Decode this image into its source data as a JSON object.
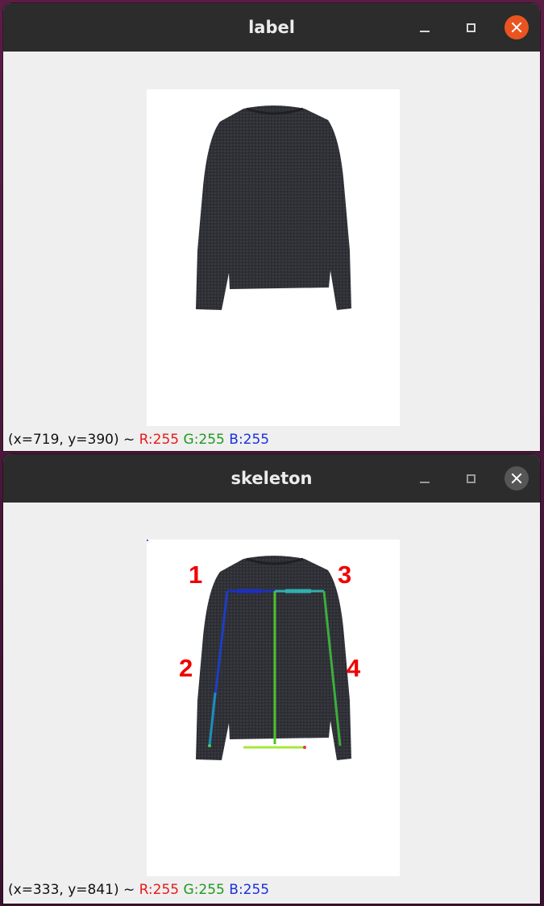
{
  "windows": [
    {
      "title": "label",
      "close_color": "#e95420",
      "status": {
        "coords": "(x=719, y=390) ~ ",
        "r": "R:255",
        "g": "G:255",
        "b": "B:255"
      }
    },
    {
      "title": "skeleton",
      "close_color": "#565656",
      "status": {
        "coords": "(x=333, y=841) ~ ",
        "r": "R:255",
        "g": "G:255",
        "b": "B:255"
      },
      "annotations": [
        "1",
        "2",
        "3",
        "4"
      ]
    }
  ],
  "icons": {
    "minimize": "minimize-icon",
    "maximize": "maximize-icon",
    "close": "close-icon"
  },
  "colors": {
    "titlebar": "#2c2c2c",
    "window_bg": "#efefef",
    "garment": "#2f3036",
    "annotation": "#f00000",
    "skeleton_blue": "#1c2fc0",
    "skeleton_cyan": "#2fb0b0",
    "skeleton_green": "#4cc22a",
    "skeleton_lime": "#a6e83a"
  }
}
